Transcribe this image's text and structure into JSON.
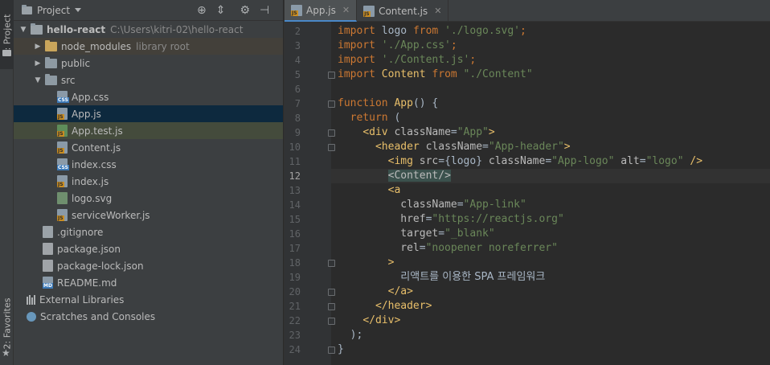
{
  "tool_strip": {
    "project_tab": "1: Project",
    "favorites_tab": "2: Favorites"
  },
  "panel": {
    "title": "Project",
    "tree": [
      {
        "label": "hello-react",
        "hint": "C:\\Users\\kitri-02\\hello-react",
        "kind": "project",
        "indent": 0,
        "expanded": true
      },
      {
        "label": "node_modules",
        "hint": "library root",
        "kind": "folder-nm",
        "indent": 1,
        "expanded": false
      },
      {
        "label": "public",
        "kind": "folder",
        "indent": 1,
        "expanded": false
      },
      {
        "label": "src",
        "kind": "folder",
        "indent": 1,
        "expanded": true
      },
      {
        "label": "App.css",
        "kind": "css",
        "indent": 2
      },
      {
        "label": "App.js",
        "kind": "js",
        "indent": 2,
        "selected": true
      },
      {
        "label": "App.test.js",
        "kind": "test",
        "indent": 2,
        "green": true
      },
      {
        "label": "Content.js",
        "kind": "js",
        "indent": 2
      },
      {
        "label": "index.css",
        "kind": "css",
        "indent": 2
      },
      {
        "label": "index.js",
        "kind": "js",
        "indent": 2
      },
      {
        "label": "logo.svg",
        "kind": "svg",
        "indent": 2
      },
      {
        "label": "serviceWorker.js",
        "kind": "js",
        "indent": 2
      },
      {
        "label": ".gitignore",
        "kind": "plain",
        "indent": 1
      },
      {
        "label": "package.json",
        "kind": "json",
        "indent": 1
      },
      {
        "label": "package-lock.json",
        "kind": "json",
        "indent": 1
      },
      {
        "label": "README.md",
        "kind": "md",
        "indent": 1
      },
      {
        "label": "External Libraries",
        "kind": "lib",
        "indent": 0
      },
      {
        "label": "Scratches and Consoles",
        "kind": "scratch",
        "indent": 0
      }
    ]
  },
  "editor": {
    "tabs": [
      {
        "label": "App.js",
        "active": true
      },
      {
        "label": "Content.js",
        "active": false
      }
    ],
    "current_line": 12,
    "lines": [
      {
        "n": 2,
        "tokens": [
          [
            "kw",
            "import"
          ],
          [
            "id",
            " logo "
          ],
          [
            "kw",
            "from"
          ],
          [
            "str",
            " './logo.svg'"
          ],
          [
            "kw",
            ";"
          ]
        ]
      },
      {
        "n": 3,
        "tokens": [
          [
            "kw",
            "import"
          ],
          [
            "str",
            " './App.css'"
          ],
          [
            "kw",
            ";"
          ]
        ]
      },
      {
        "n": 4,
        "tokens": [
          [
            "kw",
            "import"
          ],
          [
            "str",
            " './Content.js'"
          ],
          [
            "kw",
            ";"
          ]
        ]
      },
      {
        "n": 5,
        "tokens": [
          [
            "kw",
            "import"
          ],
          [
            "id",
            " "
          ],
          [
            "comp",
            "Content"
          ],
          [
            "id",
            " "
          ],
          [
            "kw",
            "from"
          ],
          [
            "str",
            " \"./Content\""
          ]
        ]
      },
      {
        "n": 6,
        "tokens": []
      },
      {
        "n": 7,
        "tokens": [
          [
            "kw",
            "function"
          ],
          [
            "id",
            " "
          ],
          [
            "comp",
            "App"
          ],
          [
            "id",
            "() {"
          ]
        ]
      },
      {
        "n": 8,
        "tokens": [
          [
            "id",
            "  "
          ],
          [
            "kw",
            "return"
          ],
          [
            "id",
            " ("
          ]
        ]
      },
      {
        "n": 9,
        "tokens": [
          [
            "id",
            "    "
          ],
          [
            "tag",
            "<div"
          ],
          [
            "attr",
            " className"
          ],
          [
            "id",
            "="
          ],
          [
            "str",
            "\"App\""
          ],
          [
            "tag",
            ">"
          ]
        ]
      },
      {
        "n": 10,
        "tokens": [
          [
            "id",
            "      "
          ],
          [
            "tag",
            "<header"
          ],
          [
            "attr",
            " className"
          ],
          [
            "id",
            "="
          ],
          [
            "str",
            "\"App-header\""
          ],
          [
            "tag",
            ">"
          ]
        ]
      },
      {
        "n": 11,
        "tokens": [
          [
            "id",
            "        "
          ],
          [
            "tag",
            "<img"
          ],
          [
            "attr",
            " src"
          ],
          [
            "id",
            "={logo} "
          ],
          [
            "attr",
            "className"
          ],
          [
            "id",
            "="
          ],
          [
            "str",
            "\"App-logo\""
          ],
          [
            "attr",
            " alt"
          ],
          [
            "id",
            "="
          ],
          [
            "str",
            "\"logo\""
          ],
          [
            "tag",
            " />"
          ]
        ]
      },
      {
        "n": 12,
        "tokens": [
          [
            "id",
            "        "
          ],
          [
            "hl",
            "<Content/>"
          ]
        ]
      },
      {
        "n": 13,
        "tokens": [
          [
            "id",
            "        "
          ],
          [
            "tag",
            "<a"
          ]
        ]
      },
      {
        "n": 14,
        "tokens": [
          [
            "attr",
            "          className"
          ],
          [
            "id",
            "="
          ],
          [
            "str",
            "\"App-link\""
          ]
        ]
      },
      {
        "n": 15,
        "tokens": [
          [
            "attr",
            "          href"
          ],
          [
            "id",
            "="
          ],
          [
            "str",
            "\"https://reactjs.org\""
          ]
        ]
      },
      {
        "n": 16,
        "tokens": [
          [
            "attr",
            "          target"
          ],
          [
            "id",
            "="
          ],
          [
            "str",
            "\"_blank\""
          ]
        ]
      },
      {
        "n": 17,
        "tokens": [
          [
            "attr",
            "          rel"
          ],
          [
            "id",
            "="
          ],
          [
            "str",
            "\"noopener noreferrer\""
          ]
        ]
      },
      {
        "n": 18,
        "tokens": [
          [
            "id",
            "        "
          ],
          [
            "tag",
            ">"
          ]
        ]
      },
      {
        "n": 19,
        "tokens": [
          [
            "id",
            "          "
          ],
          [
            "kr",
            "리액트를 이용한 SPA 프레임워크"
          ]
        ]
      },
      {
        "n": 20,
        "tokens": [
          [
            "id",
            "        "
          ],
          [
            "tag",
            "</a>"
          ]
        ]
      },
      {
        "n": 21,
        "tokens": [
          [
            "id",
            "      "
          ],
          [
            "tag",
            "</header>"
          ]
        ]
      },
      {
        "n": 22,
        "tokens": [
          [
            "id",
            "    "
          ],
          [
            "tag",
            "</div>"
          ]
        ]
      },
      {
        "n": 23,
        "tokens": [
          [
            "id",
            "  );"
          ]
        ]
      },
      {
        "n": 24,
        "tokens": [
          [
            "id",
            "}"
          ]
        ]
      }
    ]
  }
}
